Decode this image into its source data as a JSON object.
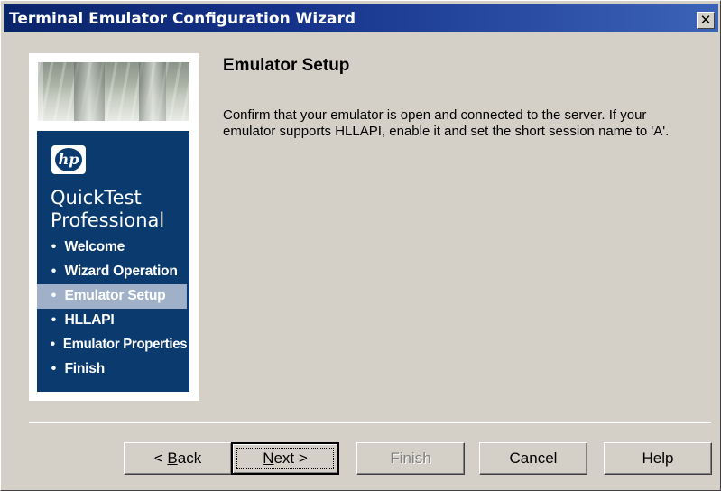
{
  "window": {
    "title": "Terminal Emulator Configuration Wizard",
    "close_glyph": "✕"
  },
  "sidebar": {
    "logo_text": "hp",
    "product_name": "QuickTest Professional",
    "bullet": "•",
    "items": [
      {
        "label": "Welcome",
        "active": false
      },
      {
        "label": "Wizard Operation",
        "active": false
      },
      {
        "label": "Emulator Setup",
        "active": true
      },
      {
        "label": "HLLAPI",
        "active": false
      },
      {
        "label": "Emulator Properties",
        "active": false
      },
      {
        "label": "Finish",
        "active": false
      }
    ]
  },
  "page": {
    "heading": "Emulator Setup",
    "description": "Confirm that your emulator is open and connected to the server.  If your emulator supports HLLAPI, enable it and set the short session name to 'A'."
  },
  "buttons": {
    "back": {
      "prefix": "< ",
      "mnemonic": "B",
      "rest": "ack"
    },
    "next": {
      "mnemonic": "N",
      "rest": "ext >"
    },
    "finish": "Finish",
    "cancel": "Cancel",
    "help": "Help"
  },
  "colors": {
    "title_bar_start": "#0a246a",
    "title_bar_end": "#3b63b7",
    "sidebar_blue": "#0a3a6e",
    "active_item": "#9fb0c8",
    "dialog_face": "#d4d0c8"
  }
}
